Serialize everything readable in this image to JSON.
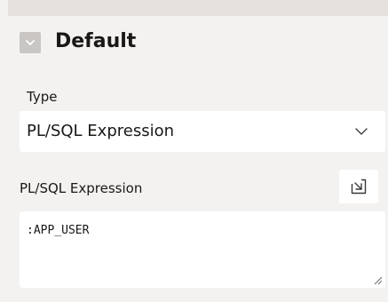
{
  "section": {
    "title": "Default",
    "toggle_icon": "chevron-toggle-icon"
  },
  "type_field": {
    "label": "Type",
    "value": "PL/SQL Expression",
    "icon": "chevron-down-icon"
  },
  "expression_field": {
    "label": "PL/SQL Expression",
    "value": ":APP_USER",
    "expand_icon": "expand-arrow-icon"
  },
  "colors": {
    "panel_background": "#f4f2f0",
    "field_background": "#ffffff",
    "toggle_background": "#c9c6c3",
    "text": "#1a1816"
  }
}
